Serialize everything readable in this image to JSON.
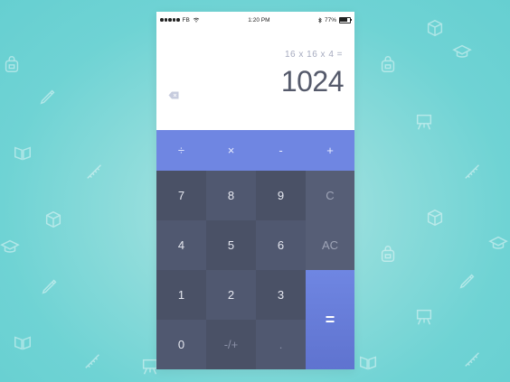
{
  "status_bar": {
    "carrier": "FB",
    "time": "1:20 PM",
    "battery": "77%"
  },
  "display": {
    "expression": "16 x 16 x 4 =",
    "result": "1024"
  },
  "operators": [
    "÷",
    "×",
    "-",
    "+"
  ],
  "keys": {
    "k7": "7",
    "k8": "8",
    "k9": "9",
    "k4": "4",
    "k5": "5",
    "k6": "6",
    "k1": "1",
    "k2": "2",
    "k3": "3",
    "k0": "0",
    "sign": "-/+",
    "dot": ".",
    "clear": "C",
    "all_clear": "AC",
    "equals": "="
  },
  "colors": {
    "background": "#6fd3d4",
    "operator_row": "#6f86e2",
    "keypad": "#4a5166",
    "equals": "#6578d8"
  }
}
